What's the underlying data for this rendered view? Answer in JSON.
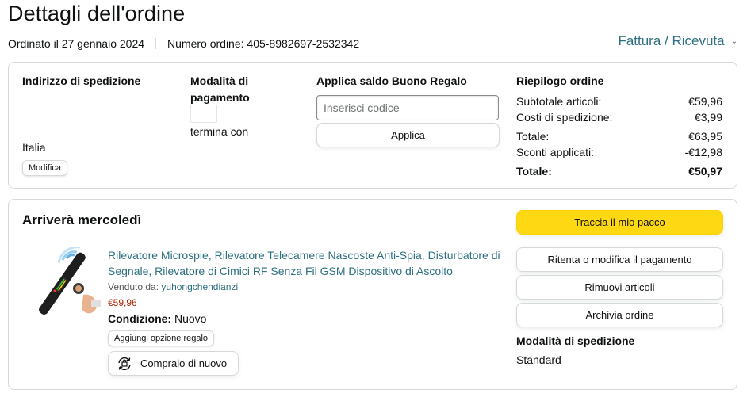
{
  "page": {
    "title": "Dettagli dell'ordine",
    "ordered_on": "Ordinato il 27 gennaio 2024",
    "order_number": "Numero ordine: 405-8982697-2532342",
    "invoice_link": "Fattura / Ricevuta"
  },
  "shipping_address": {
    "title": "Indirizzo di spedizione",
    "country": "Italia",
    "edit_label": "Modifica"
  },
  "payment": {
    "title_line1": "Modalità di",
    "title_line2": "pagamento",
    "card_text": "termina con"
  },
  "gift": {
    "title": "Applica saldo Buono Regalo",
    "placeholder": "Inserisci codice",
    "apply_label": "Applica"
  },
  "summary": {
    "title": "Riepilogo ordine",
    "rows": [
      {
        "label": "Subtotale articoli:",
        "value": "€59,96"
      },
      {
        "label": "Costi di spedizione:",
        "value": "€3,99"
      },
      {
        "label": "Totale:",
        "value": "€63,95"
      },
      {
        "label": "Sconti applicati:",
        "value": "-€12,98"
      }
    ],
    "grand_total_label": "Totale:",
    "grand_total_value": "€50,97"
  },
  "shipment": {
    "title": "Arriverà mercoledì",
    "product": {
      "title": "Rilevatore Microspie, Rilevatore Telecamere Nascoste Anti-Spia, Disturbatore di Segnale, Rilevatore di Cimici RF Senza Fil GSM Dispositivo di Ascolto",
      "sold_by_label": "Venduto da:",
      "seller": "yuhongchendianzi",
      "price": "€59,96",
      "condition_label": "Condizione:",
      "condition_value": "Nuovo",
      "gift_option_label": "Aggiungi opzione regalo",
      "rebuy_label": "Compralo di nuovo"
    },
    "actions": {
      "track": "Traccia il mio pacco",
      "retry_payment": "Ritenta o modifica il pagamento",
      "remove_items": "Rimuovi articoli",
      "archive": "Archivia ordine"
    },
    "shipping_method_title": "Modalità di spedizione",
    "shipping_method_value": "Standard"
  },
  "icons": {
    "invoice_chevron": "chevron-down-icon",
    "rebuy": "rebuy-icon",
    "product": "product-image"
  },
  "colors": {
    "link": "#2e6f80",
    "price": "#b12704",
    "primary_button": "#ffd814",
    "border": "#d5d9d9"
  }
}
